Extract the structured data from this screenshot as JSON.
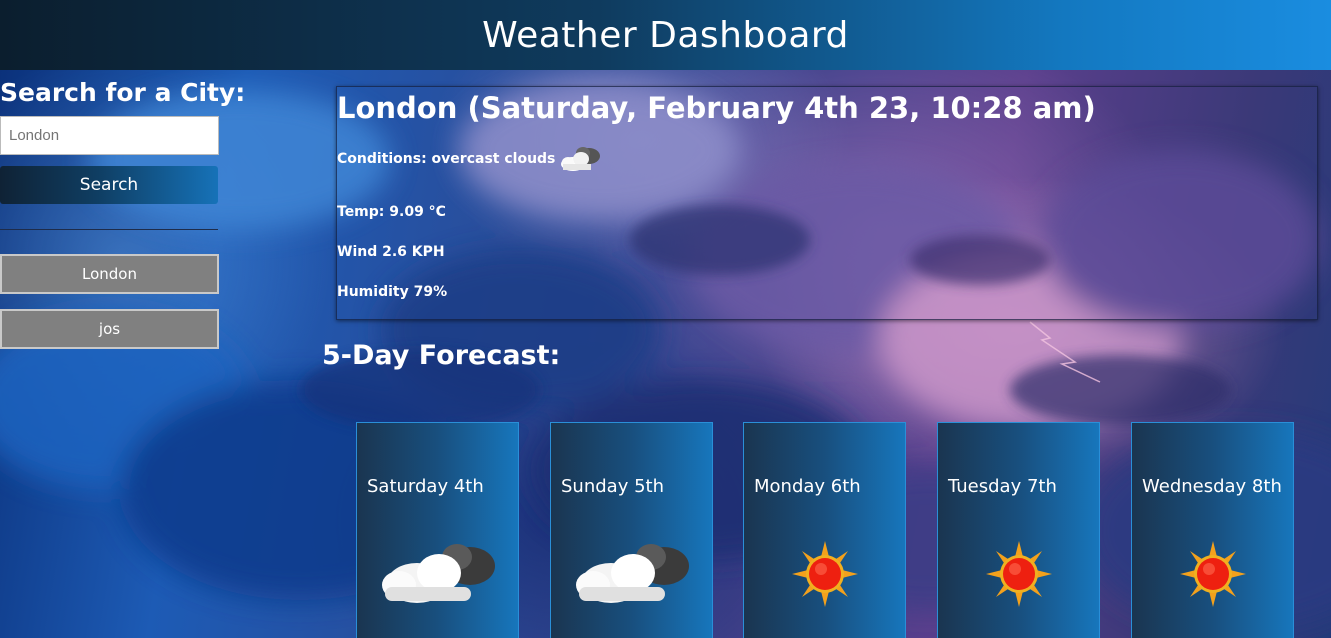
{
  "header": {
    "title": "Weather Dashboard"
  },
  "sidebar": {
    "heading": "Search for a City:",
    "search_placeholder": "London",
    "search_button": "Search",
    "history": [
      "London",
      "jos"
    ]
  },
  "current": {
    "title": "London (Saturday, February 4th 23, 10:28 am)",
    "conditions": "Conditions: overcast clouds",
    "conditions_icon": "overcast-clouds-icon",
    "temp": "Temp: 9.09 °C",
    "wind": "Wind 2.6 KPH",
    "humidity": "Humidity 79%"
  },
  "forecast": {
    "title": "5-Day Forecast:",
    "days": [
      {
        "day": "Saturday 4th",
        "icon": "cloudy-icon"
      },
      {
        "day": "Sunday 5th",
        "icon": "cloudy-icon"
      },
      {
        "day": "Monday 6th",
        "icon": "sun-icon"
      },
      {
        "day": "Tuesday 7th",
        "icon": "sun-icon"
      },
      {
        "day": "Wednesday 8th",
        "icon": "sun-icon"
      }
    ]
  },
  "colors": {
    "header_dark": "#0b1e2e",
    "header_light": "#1a8de0",
    "history_button": "#808080",
    "card_border": "#2a8fd8"
  }
}
